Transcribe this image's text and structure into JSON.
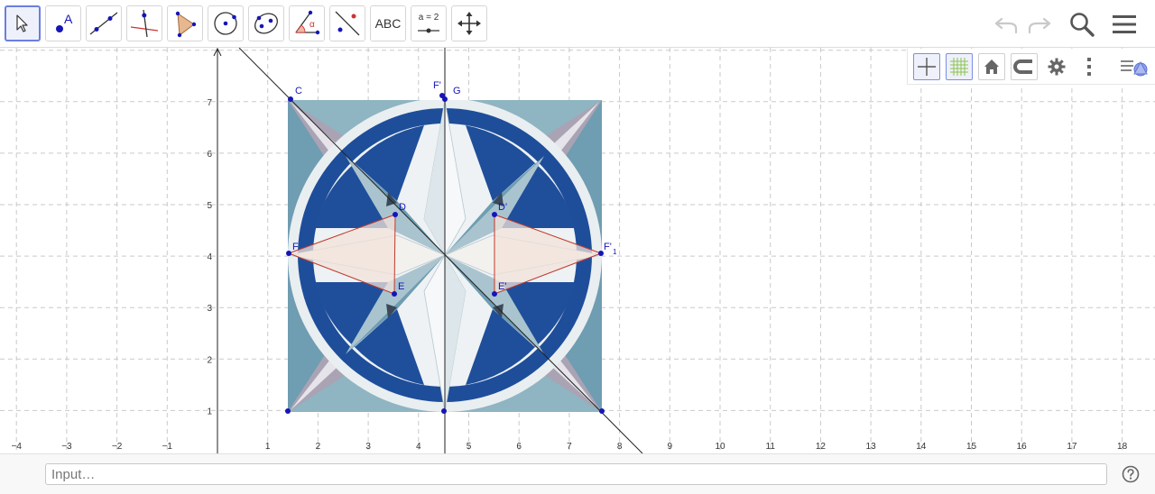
{
  "toolbar": {
    "tools": [
      {
        "id": "move",
        "icon": "arrow-pointer-icon"
      },
      {
        "id": "point",
        "icon": "point-icon",
        "label": "A"
      },
      {
        "id": "line",
        "icon": "line-through-points-icon"
      },
      {
        "id": "perpendicular",
        "icon": "perpendicular-line-icon"
      },
      {
        "id": "polygon",
        "icon": "polygon-icon"
      },
      {
        "id": "circle",
        "icon": "circle-center-point-icon"
      },
      {
        "id": "conic",
        "icon": "ellipse-icon"
      },
      {
        "id": "angle",
        "icon": "angle-icon",
        "label": "α"
      },
      {
        "id": "reflect",
        "icon": "reflect-about-line-icon"
      },
      {
        "id": "text",
        "icon": "text-icon",
        "label": "ABC"
      },
      {
        "id": "slider",
        "icon": "slider-icon",
        "label": "a = 2"
      },
      {
        "id": "move-view",
        "icon": "move-graphics-view-icon"
      }
    ],
    "right_icons": [
      "undo-icon",
      "redo-icon",
      "search-icon",
      "menu-icon"
    ]
  },
  "style_bar": {
    "buttons": [
      "axes-toggle-icon",
      "grid-toggle-icon",
      "home-icon",
      "point-capturing-icon",
      "gear-icon",
      "more-vertical-icon",
      "toggle-style-bar-icon"
    ]
  },
  "graphics": {
    "x_ticks": [
      "−4",
      "−3",
      "−2",
      "−1",
      "1",
      "2",
      "3",
      "4",
      "5",
      "6",
      "7",
      "8",
      "9",
      "10",
      "11",
      "12",
      "13",
      "14",
      "15",
      "16",
      "17",
      "18"
    ],
    "y_ticks": [
      "1",
      "2",
      "3",
      "4",
      "5",
      "6",
      "7"
    ],
    "points": {
      "C": "C",
      "Fp": "F'",
      "G": "G",
      "D": "D",
      "Dp": "D'",
      "F": "F",
      "F1": "F'",
      "F1_sub": "1",
      "E": "E",
      "Ep": "E'"
    }
  },
  "input_bar": {
    "placeholder": "Input…",
    "help_icon": "help-icon"
  },
  "colors": {
    "accent": "#6c7ee1",
    "point": "#1515b8",
    "navy": "#1e4e9a",
    "teal": "#7aa6b9",
    "mauve": "#a9a2b2"
  }
}
